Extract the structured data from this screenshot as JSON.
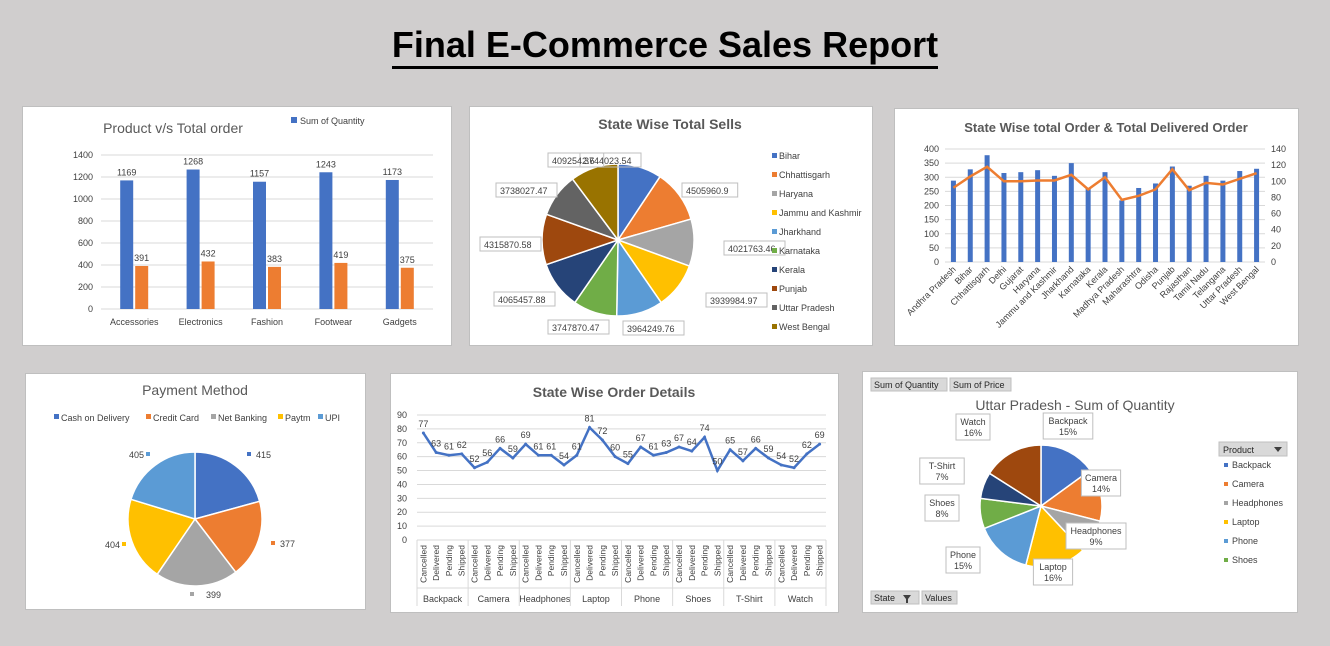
{
  "report_title": "Final E-Commerce Sales Report",
  "colors": {
    "blue": "#4472c4",
    "orange": "#ed7d31",
    "gray": "#a5a5a5",
    "yellow": "#ffc000",
    "lightblue": "#5b9bd5",
    "green": "#70ad47",
    "darkblue": "#264478",
    "brown": "#9e480e",
    "dimgray": "#636363",
    "olive": "#997300"
  },
  "chart_data": [
    {
      "id": "product_vs_order",
      "type": "bar",
      "title": "Product v/s Total order",
      "categories": [
        "Accessories",
        "Electronics",
        "Fashion",
        "Footwear",
        "Gadgets"
      ],
      "series": [
        {
          "name": "Sum of Quantity",
          "values": [
            1169,
            1268,
            1157,
            1243,
            1173
          ],
          "color": "#4472c4"
        },
        {
          "values": [
            391,
            432,
            383,
            419,
            375
          ],
          "color": "#ed7d31"
        }
      ],
      "yticks": [
        "0",
        "200",
        "400",
        "600",
        "800",
        "1000",
        "1200",
        "1400"
      ],
      "ylim": [
        0,
        1400
      ],
      "legend": "top-right"
    },
    {
      "id": "state_total_sells",
      "type": "pie",
      "title": "State Wise Total Sells",
      "labels": [
        "Bihar",
        "Chhattisgarh",
        "Haryana",
        "Jammu and Kashmir",
        "Jharkhand",
        "Karnataka",
        "Kerala",
        "Punjab",
        "Uttar Pradesh",
        "West Bengal"
      ],
      "values": [
        3744023.54,
        4505960.9,
        4021763.46,
        3939984.97,
        3964249.76,
        3747870.47,
        4065457.88,
        4315870.58,
        3738027.47,
        4092542.6
      ],
      "value_labels": [
        "3744023.54",
        "4505960.9",
        "4021763.46",
        "3939984.97",
        "3964249.76",
        "3747870.47",
        "4065457.88",
        "4315870.58",
        "3738027.47",
        "4092542.6"
      ],
      "colors": [
        "#4472c4",
        "#ed7d31",
        "#a5a5a5",
        "#ffc000",
        "#5b9bd5",
        "#70ad47",
        "#264478",
        "#9e480e",
        "#636363",
        "#997300"
      ],
      "legend": "right"
    },
    {
      "id": "state_order_delivered",
      "type": "bar",
      "title": "State Wise total Order & Total Delivered Order",
      "categories": [
        "Andhra Pradesh",
        "Bihar",
        "Chhattisgarh",
        "Delhi",
        "Gujarat",
        "Haryana",
        "Jammu and Kashmir",
        "Jharkhand",
        "Karnataka",
        "Kerala",
        "Madhya Pradesh",
        "Maharashtra",
        "Odisha",
        "Punjab",
        "Rajasthan",
        "Tamil Nadu",
        "Telangana",
        "Uttar Pradesh",
        "West Bengal"
      ],
      "series": [
        {
          "type": "bar",
          "axis": "left",
          "values": [
            288,
            328,
            378,
            315,
            318,
            325,
            305,
            350,
            262,
            318,
            218,
            262,
            278,
            338,
            270,
            305,
            288,
            322,
            330
          ],
          "color": "#4472c4"
        },
        {
          "type": "line",
          "axis": "right",
          "values": [
            92,
            106,
            118,
            100,
            100,
            101,
            101,
            108,
            90,
            105,
            77,
            82,
            90,
            115,
            89,
            98,
            96,
            103,
            110
          ],
          "color": "#ed7d31"
        }
      ],
      "yticks_left": [
        "0",
        "50",
        "100",
        "150",
        "200",
        "250",
        "300",
        "350",
        "400"
      ],
      "yticks_right": [
        "0",
        "20",
        "40",
        "60",
        "80",
        "100",
        "120",
        "140"
      ],
      "ylim_left": [
        0,
        400
      ],
      "ylim_right": [
        0,
        140
      ]
    },
    {
      "id": "payment_method",
      "type": "pie",
      "title": "Payment Method",
      "labels": [
        "Cash on Delivery",
        "Credit Card",
        "Net Banking",
        "Paytm",
        "UPI"
      ],
      "values": [
        415,
        377,
        399,
        404,
        405
      ],
      "value_labels": [
        "415",
        "377",
        "399",
        "404",
        "405"
      ],
      "colors": [
        "#4472c4",
        "#ed7d31",
        "#a5a5a5",
        "#ffc000",
        "#5b9bd5"
      ],
      "legend": "top"
    },
    {
      "id": "state_order_details",
      "type": "line",
      "title": "State Wise Order Details",
      "groups": [
        "Backpack",
        "Camera",
        "Headphones",
        "Laptop",
        "Phone",
        "Shoes",
        "T-Shirt",
        "Watch"
      ],
      "statuses": [
        "Cancelled",
        "Delivered",
        "Pending",
        "Shipped"
      ],
      "values": [
        77,
        63,
        61,
        62,
        52,
        56,
        66,
        59,
        69,
        61,
        61,
        54,
        61,
        81,
        72,
        60,
        55,
        67,
        61,
        63,
        67,
        64,
        74,
        50,
        65,
        57,
        66,
        59,
        54,
        52,
        62,
        69
      ],
      "yticks": [
        "0",
        "10",
        "20",
        "30",
        "40",
        "50",
        "60",
        "70",
        "80",
        "90"
      ],
      "ylim": [
        0,
        90
      ],
      "color": "#4472c4"
    },
    {
      "id": "up_sum_quantity",
      "type": "pie",
      "title": "Uttar Pradesh - Sum of Quantity",
      "labels": [
        "Backpack",
        "Camera",
        "Headphones",
        "Laptop",
        "Phone",
        "Shoes",
        "T-Shirt",
        "Watch"
      ],
      "values": [
        15,
        14,
        9,
        16,
        15,
        8,
        7,
        16
      ],
      "value_labels": [
        "15%",
        "14%",
        "9%",
        "16%",
        "15%",
        "8%",
        "7%",
        "16%"
      ],
      "colors": [
        "#4472c4",
        "#ed7d31",
        "#a5a5a5",
        "#ffc000",
        "#5b9bd5",
        "#70ad47",
        "#264478",
        "#9e480e"
      ],
      "legend_title": "Product",
      "legend_items": [
        "Backpack",
        "Camera",
        "Headphones",
        "Laptop",
        "Phone",
        "Shoes"
      ],
      "buttons": {
        "sum_quantity": "Sum of Quantity",
        "sum_price": "Sum of Price",
        "state": "State",
        "values": "Values"
      }
    }
  ]
}
